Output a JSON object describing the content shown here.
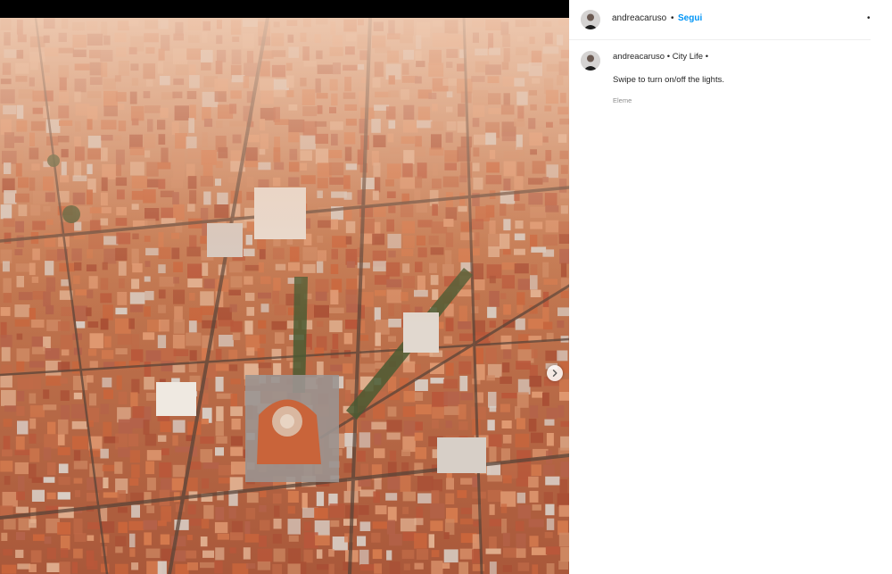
{
  "post": {
    "header": {
      "username": "andreacaruso",
      "separator": "•",
      "follow_label": "Segui",
      "more_label": "•"
    },
    "caption": {
      "username": "andreacaruso",
      "separator": "•",
      "location": "City Life",
      "trailing_dot": "•",
      "text": "Swipe to turn on/off the lights.",
      "meta": "Eleme"
    }
  },
  "colors": {
    "accent": "#0095f6",
    "roof_terracotta": "#c96a3f",
    "haze": "#e9c2a6"
  },
  "icons": {
    "next": "chevron-right-icon",
    "avatar": "user-avatar"
  }
}
